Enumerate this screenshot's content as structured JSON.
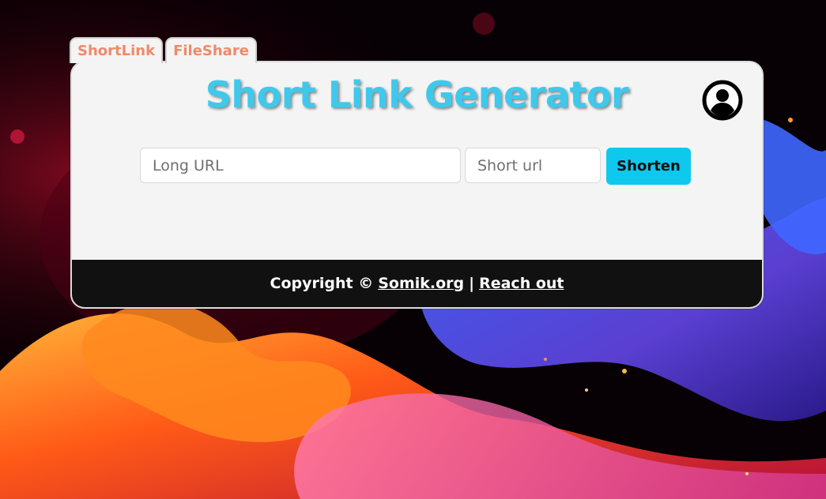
{
  "tabs": [
    {
      "label": "ShortLink"
    },
    {
      "label": "FileShare"
    }
  ],
  "header": {
    "title": "Short Link Generator",
    "avatar_icon": "account-circle-icon"
  },
  "form": {
    "long_url": {
      "placeholder": "Long URL",
      "value": ""
    },
    "short_url": {
      "placeholder": "Short url",
      "value": ""
    },
    "submit_label": "Shorten"
  },
  "footer": {
    "copyright": "Copyright ©",
    "site_link": "Somik.org",
    "separator": "|",
    "contact_link": "Reach out"
  },
  "colors": {
    "accent": "#0fc8ee",
    "title": "#3ec9ec",
    "tab_text": "#ee8a6a",
    "footer_bg": "#111111",
    "card_bg": "#f4f4f4"
  }
}
